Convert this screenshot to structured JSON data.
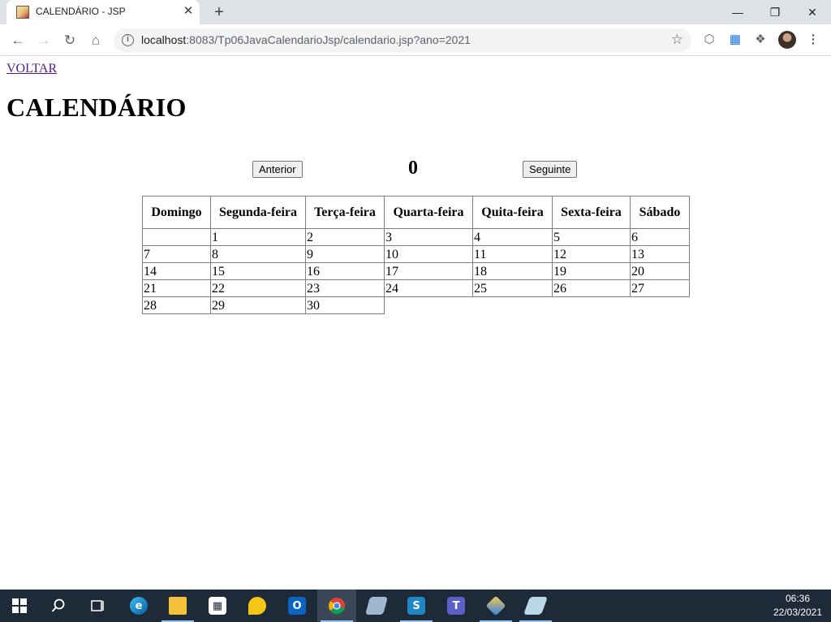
{
  "browser": {
    "tab_title": "CALENDÁRIO - JSP",
    "tab_close": "✕",
    "new_tab": "+",
    "url_host": "localhost",
    "url_rest": ":8083/Tp06JavaCalendarioJsp/calendario.jsp?ano=2021",
    "icons": [
      "back-icon",
      "forward-icon",
      "reload-icon",
      "home-icon",
      "info-icon",
      "star-icon",
      "extension-shield-icon",
      "grid-extension-icon",
      "puzzle-icon",
      "profile-avatar",
      "menu-icon"
    ]
  },
  "page": {
    "back_link": "VOLTAR",
    "title": "CALENDÁRIO",
    "prev_button": "Anterior",
    "next_button": "Seguinte",
    "year_value": "0",
    "calendar": {
      "headers": [
        "Domingo",
        "Segunda-feira",
        "Terça-feira",
        "Quarta-feira",
        "Quita-feira",
        "Sexta-feira",
        "Sábado"
      ],
      "weeks": [
        [
          "",
          "1",
          "2",
          "3",
          "4",
          "5",
          "6"
        ],
        [
          "7",
          "8",
          "9",
          "10",
          "11",
          "12",
          "13"
        ],
        [
          "14",
          "15",
          "16",
          "17",
          "18",
          "19",
          "20"
        ],
        [
          "21",
          "22",
          "23",
          "24",
          "25",
          "26",
          "27"
        ],
        [
          "28",
          "29",
          "30"
        ]
      ]
    }
  },
  "taskbar": {
    "time": "06:36",
    "date": "22/03/2021",
    "apps": [
      "start",
      "search",
      "task-view",
      "edge",
      "file-explorer",
      "store",
      "app-yellow",
      "outlook",
      "chrome",
      "app-notes",
      "app-s",
      "teams",
      "app-cube",
      "app-pen"
    ]
  }
}
